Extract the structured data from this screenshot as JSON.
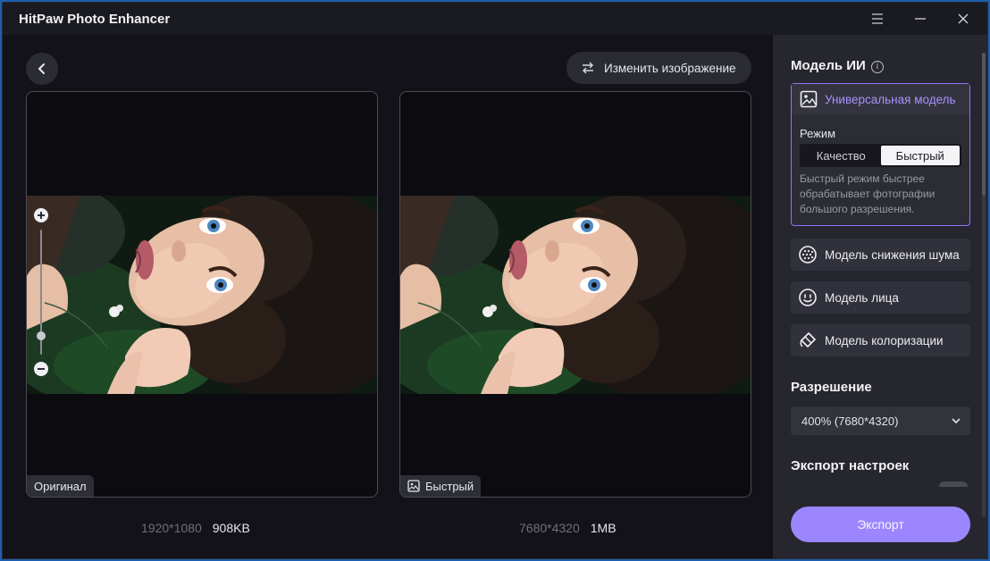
{
  "app": {
    "title": "HitPaw Photo Enhancer"
  },
  "toolbar": {
    "change_image_label": "Изменить изображение"
  },
  "preview": {
    "original": {
      "tag": "Оригинал",
      "resolution": "1920*1080",
      "size": "908KB"
    },
    "enhanced": {
      "tag": "Быстрый",
      "resolution": "7680*4320",
      "size": "1MB"
    },
    "zoom_level": 0.15
  },
  "sidebar": {
    "ai_model_title": "Модель ИИ",
    "universal_model": "Универсальная модель",
    "mode_label": "Режим",
    "mode_options": [
      "Качество",
      "Быстрый"
    ],
    "mode_selected": "Быстрый",
    "mode_description": "Быстрый режим быстрее обрабатывает фотографии большого разрешения.",
    "models": [
      {
        "label": "Модель снижения шума",
        "icon": "noise-icon"
      },
      {
        "label": "Модель лица",
        "icon": "face-icon"
      },
      {
        "label": "Модель колоризации",
        "icon": "colorize-icon"
      }
    ],
    "resolution_title": "Разрешение",
    "resolution_value": "400% (7680*4320)",
    "export_settings_title": "Экспорт настроек",
    "export_label": "Экспорт"
  },
  "colors": {
    "accent": "#9c86ff",
    "accent_border": "#8c74ff",
    "background": "#121218",
    "sidebar": "#26262e"
  }
}
